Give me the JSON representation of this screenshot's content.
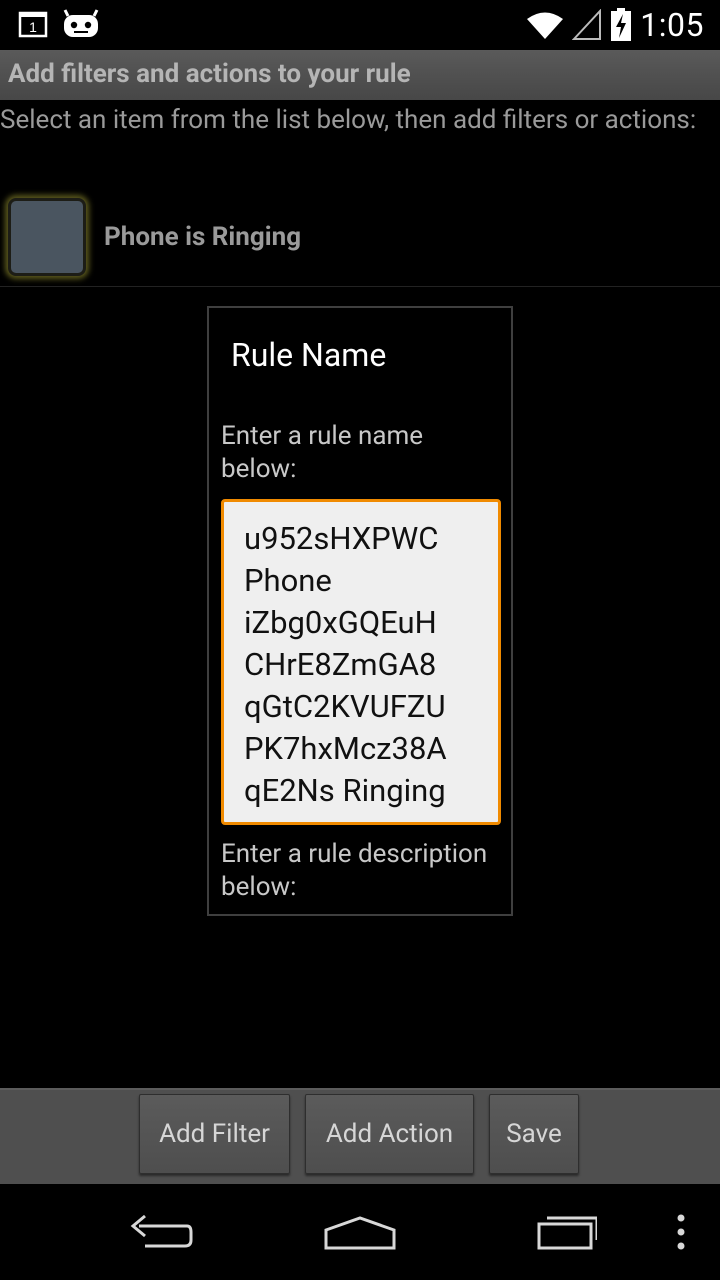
{
  "status_bar": {
    "time": "1:05",
    "calendar_badge": "1",
    "icons": [
      "calendar-icon",
      "cyanogen-bot-icon",
      "wifi-icon",
      "signal-icon",
      "battery-charging-icon"
    ]
  },
  "header": {
    "title": "Add filters and actions to your rule"
  },
  "instructions": "Select an item from the list below, then add filters or actions:",
  "list": {
    "items": [
      {
        "label": "Phone is Ringing",
        "icon": "phone-ringing-thumbnail"
      }
    ]
  },
  "dialog": {
    "title": "Rule Name",
    "name_prompt": "Enter a rule name below:",
    "name_value": "u952sHXPWC Phone iZbg0xGQEuH CHrE8ZmGA8 qGtC2KVUFZU PK7hxMcz38A qE2Ns Ringing",
    "description_prompt": "Enter a rule description below:"
  },
  "buttons": {
    "add_filter": "Add Filter",
    "add_action": "Add Action",
    "save": "Save"
  },
  "nav": {
    "icons": [
      "back-icon",
      "home-icon",
      "recents-icon",
      "overflow-menu-icon"
    ]
  },
  "colors": {
    "accent_focus": "#f08a00",
    "title_bar": "#4d4d4d",
    "button_bar": "#4f4f4f"
  }
}
